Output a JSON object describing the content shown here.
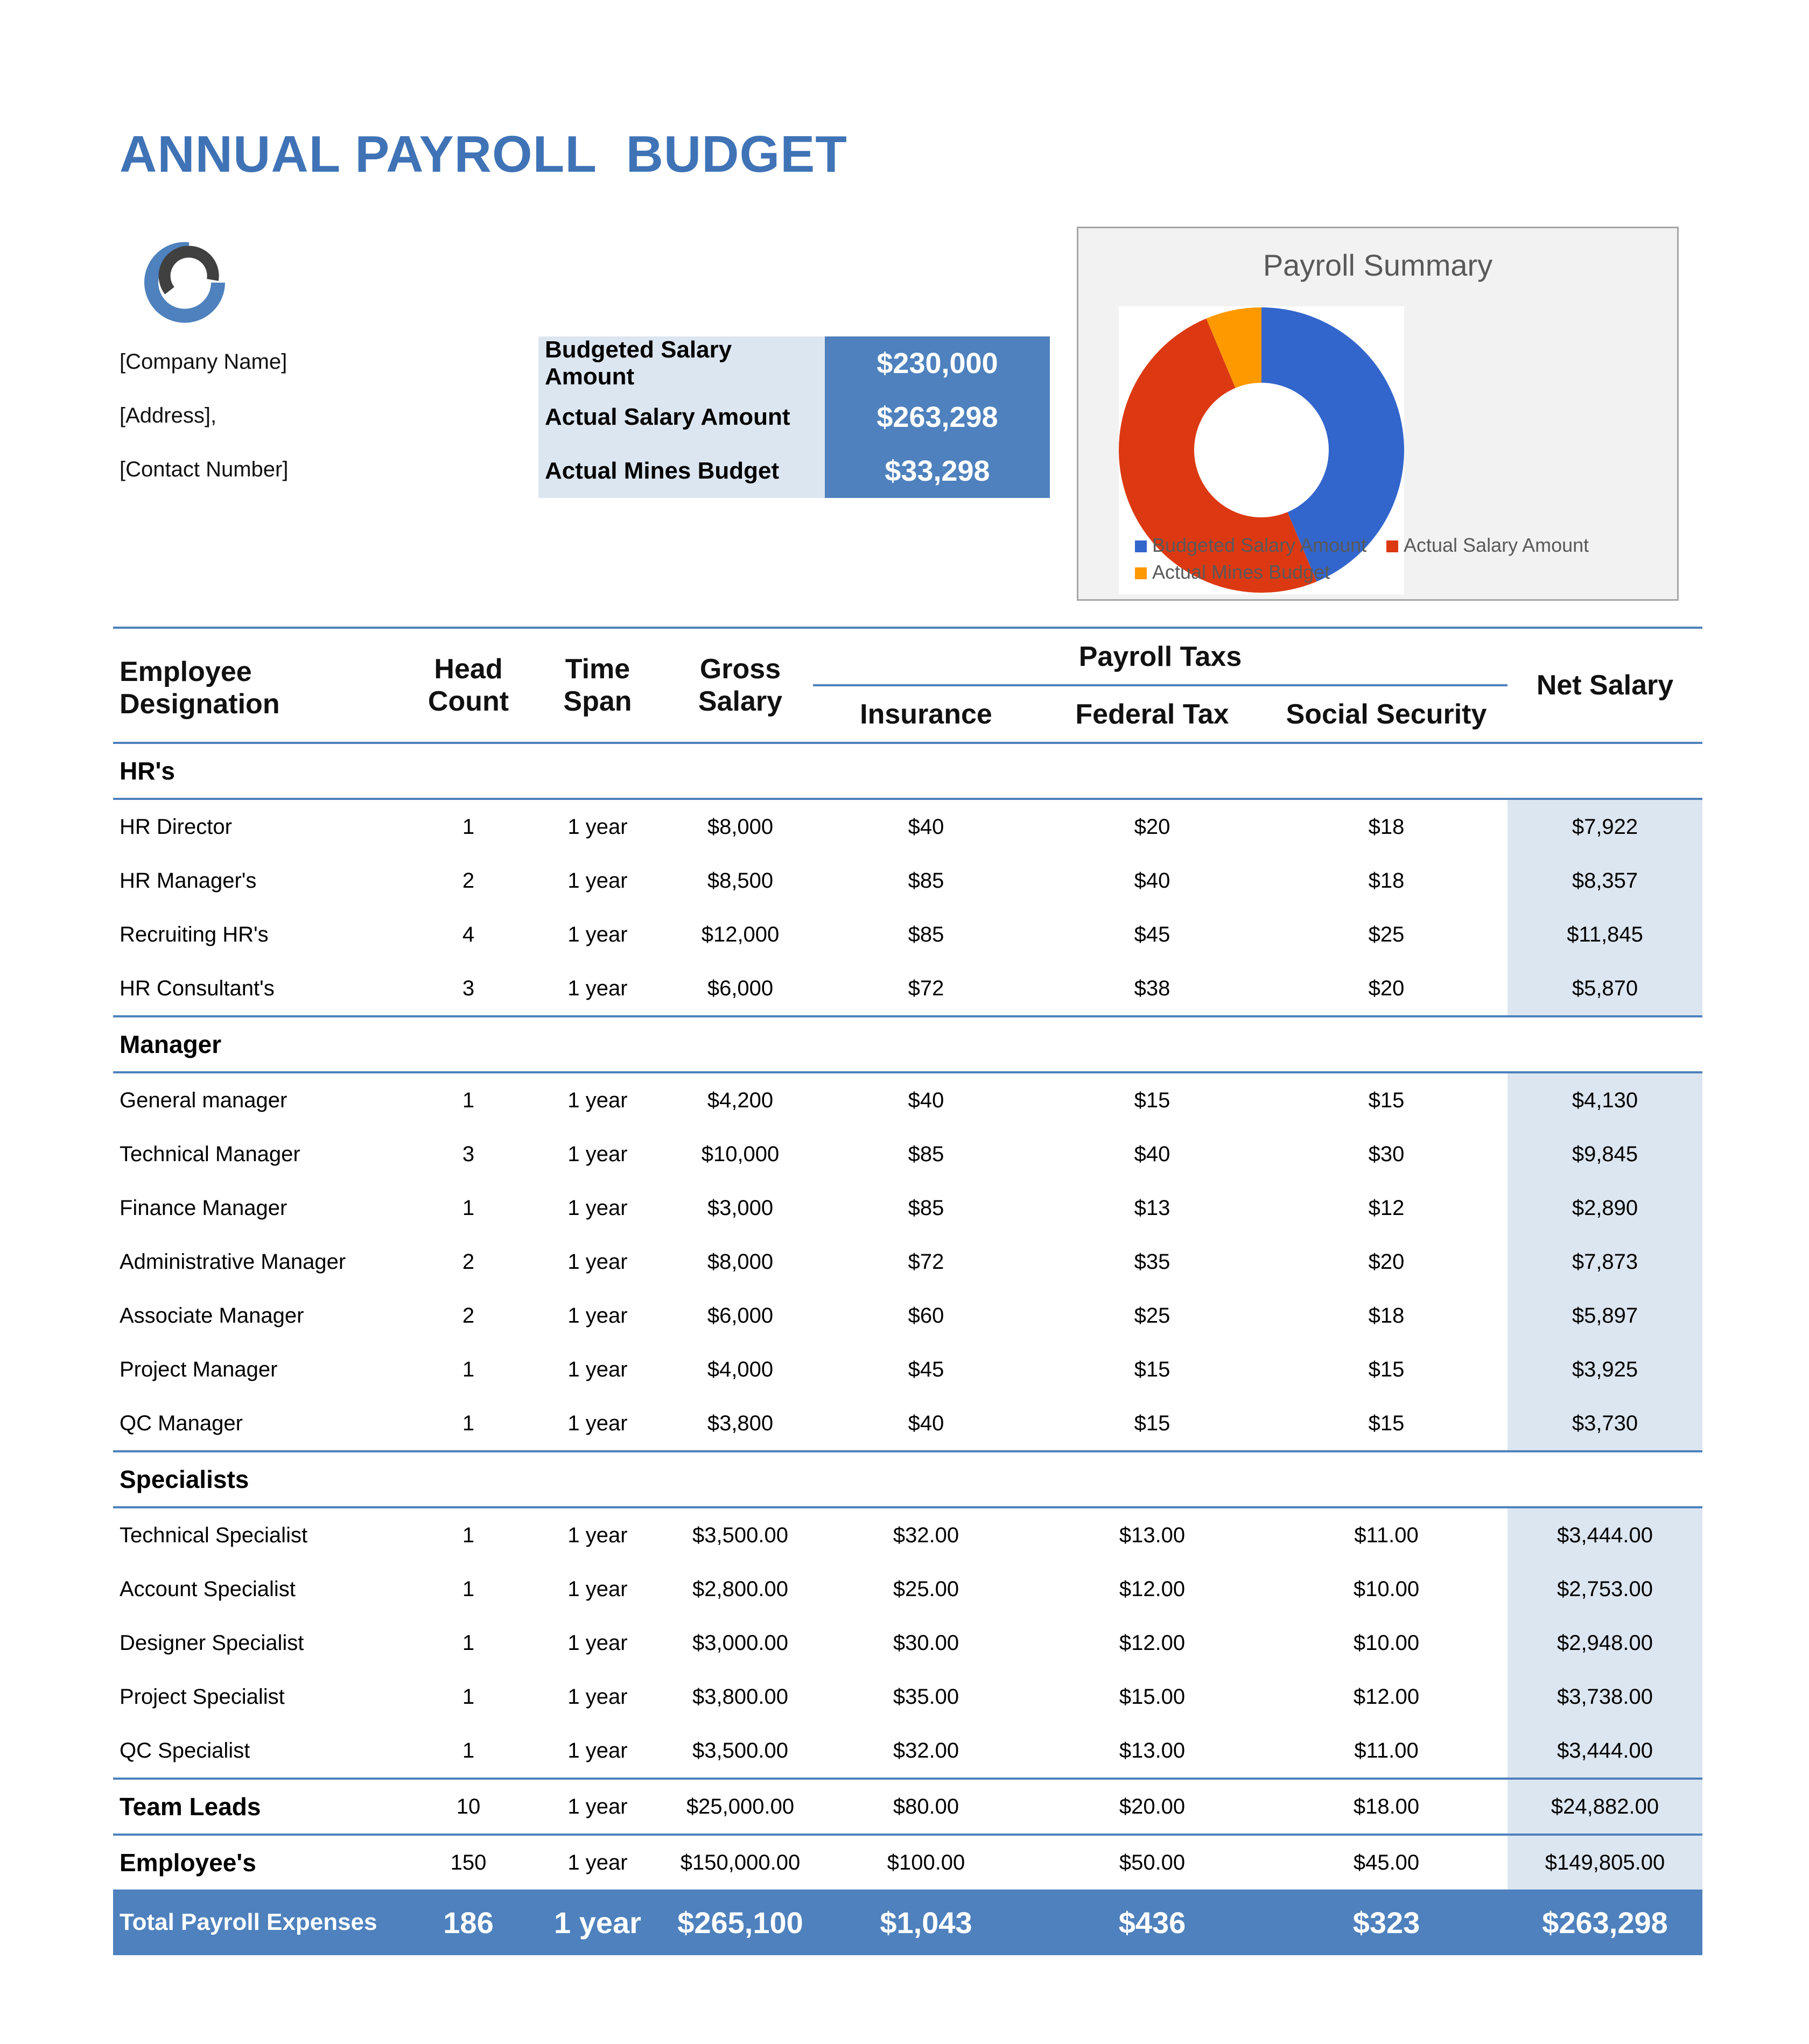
{
  "title": "ANNUAL PAYROLL  BUDGET",
  "company": {
    "name": "[Company Name]",
    "address": "[Address],",
    "contact": "[Contact Number]"
  },
  "summary": [
    {
      "label": "Budgeted Salary Amount",
      "value": "$230,000"
    },
    {
      "label": "Actual Salary Amount",
      "value": "$263,298"
    },
    {
      "label": "Actual Mines Budget",
      "value": "$33,298"
    }
  ],
  "colors": {
    "accent": "#3f73b6",
    "table_blue": "#4e81bd",
    "light_blue": "#dce6f1",
    "series_budgeted": "#3366cc",
    "series_actual": "#dc3912",
    "series_mines": "#ff9900"
  },
  "chart_data": {
    "type": "pie",
    "title": "Payroll Summary",
    "labels": [
      "Budgeted Salary Amount",
      "Actual Salary Amount",
      "Actual Mines Budget"
    ],
    "values": [
      230000,
      263298,
      33298
    ],
    "donut": true,
    "legend_position": "bottom"
  },
  "table": {
    "headers": {
      "designation": "Employee Designation",
      "head_count": "Head Count",
      "time_span": "Time Span",
      "gross_salary": "Gross Salary",
      "payroll_taxes": "Payroll Taxs",
      "insurance": "Insurance",
      "federal_tax": "Federal Tax",
      "social_security": "Social Security",
      "net_salary": "Net Salary"
    },
    "sections": {
      "hr": "HR's",
      "manager": "Manager",
      "specialists": "Specialists"
    },
    "hr_rows": [
      [
        "HR Director",
        "1",
        "1 year",
        "$8,000",
        "$40",
        "$20",
        "$18",
        "$7,922"
      ],
      [
        "HR Manager's",
        "2",
        "1 year",
        "$8,500",
        "$85",
        "$40",
        "$18",
        "$8,357"
      ],
      [
        "Recruiting HR's",
        "4",
        "1 year",
        "$12,000",
        "$85",
        "$45",
        "$25",
        "$11,845"
      ],
      [
        "HR Consultant's",
        "3",
        "1 year",
        "$6,000",
        "$72",
        "$38",
        "$20",
        "$5,870"
      ]
    ],
    "manager_rows": [
      [
        "General manager",
        "1",
        "1 year",
        "$4,200",
        "$40",
        "$15",
        "$15",
        "$4,130"
      ],
      [
        "Technical Manager",
        "3",
        "1 year",
        "$10,000",
        "$85",
        "$40",
        "$30",
        "$9,845"
      ],
      [
        "Finance Manager",
        "1",
        "1 year",
        "$3,000",
        "$85",
        "$13",
        "$12",
        "$2,890"
      ],
      [
        "Administrative Manager",
        "2",
        "1 year",
        "$8,000",
        "$72",
        "$35",
        "$20",
        "$7,873"
      ],
      [
        "Associate Manager",
        "2",
        "1 year",
        "$6,000",
        "$60",
        "$25",
        "$18",
        "$5,897"
      ],
      [
        "Project Manager",
        "1",
        "1 year",
        "$4,000",
        "$45",
        "$15",
        "$15",
        "$3,925"
      ],
      [
        "QC Manager",
        "1",
        "1 year",
        "$3,800",
        "$40",
        "$15",
        "$15",
        "$3,730"
      ]
    ],
    "specialist_rows": [
      [
        "Technical Specialist",
        "1",
        "1 year",
        "$3,500.00",
        "$32.00",
        "$13.00",
        "$11.00",
        "$3,444.00"
      ],
      [
        "Account Specialist",
        "1",
        "1 year",
        "$2,800.00",
        "$25.00",
        "$12.00",
        "$10.00",
        "$2,753.00"
      ],
      [
        "Designer Specialist",
        "1",
        "1 year",
        "$3,000.00",
        "$30.00",
        "$12.00",
        "$10.00",
        "$2,948.00"
      ],
      [
        "Project Specialist",
        "1",
        "1 year",
        "$3,800.00",
        "$35.00",
        "$15.00",
        "$12.00",
        "$3,738.00"
      ],
      [
        "QC Specialist",
        "1",
        "1 year",
        "$3,500.00",
        "$32.00",
        "$13.00",
        "$11.00",
        "$3,444.00"
      ]
    ],
    "team_leads": [
      "Team Leads",
      "10",
      "1 year",
      "$25,000.00",
      "$80.00",
      "$20.00",
      "$18.00",
      "$24,882.00"
    ],
    "employees": [
      "Employee's",
      "150",
      "1 year",
      "$150,000.00",
      "$100.00",
      "$50.00",
      "$45.00",
      "$149,805.00"
    ],
    "total": [
      "Total Payroll Expenses",
      "186",
      "1 year",
      "$265,100",
      "$1,043",
      "$436",
      "$323",
      "$263,298"
    ]
  }
}
